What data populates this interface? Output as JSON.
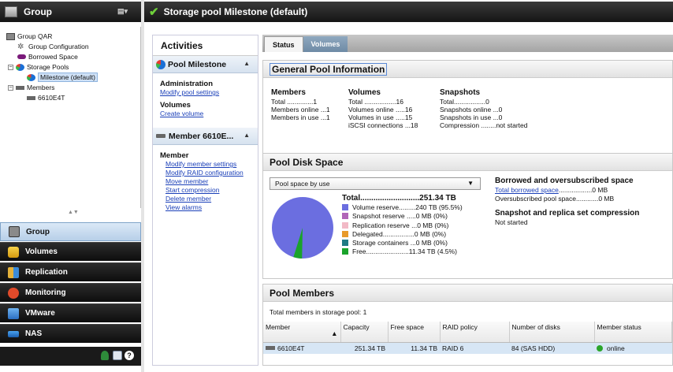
{
  "left": {
    "title": "Group",
    "tree": [
      {
        "label": "Group QAR"
      },
      {
        "label": "Group Configuration"
      },
      {
        "label": "Borrowed Space"
      },
      {
        "label": "Storage Pools"
      },
      {
        "label": "Milestone (default)"
      },
      {
        "label": "Members"
      },
      {
        "label": "6610E4T"
      }
    ],
    "nav": [
      "Group",
      "Volumes",
      "Replication",
      "Monitoring",
      "VMware",
      "NAS"
    ]
  },
  "main": {
    "title": "Storage pool Milestone (default)"
  },
  "activities": {
    "title": "Activities",
    "pool_section": "Pool Milestone",
    "admin_header": "Administration",
    "admin_links": [
      "Modify pool settings"
    ],
    "volumes_header": "Volumes",
    "volumes_links": [
      "Create volume"
    ],
    "member_section": "Member 6610E...",
    "member_header": "Member",
    "member_links": [
      "Modify member settings",
      "Modify RAID configuration",
      "Move member",
      "Start compression",
      "Delete member",
      "View alarms"
    ]
  },
  "tabs": [
    "Status",
    "Volumes"
  ],
  "general": {
    "title": "General Pool Information",
    "members": {
      "header": "Members",
      "rows": [
        "Total ..............1",
        "Members online ...1",
        "Members in use ...1"
      ]
    },
    "volumes": {
      "header": "Volumes",
      "rows": [
        "Total .................16",
        "Volumes online .....16",
        "Volumes in use .....15",
        "iSCSI connections ...18"
      ]
    },
    "snapshots": {
      "header": "Snapshots",
      "rows": [
        "Total.................0",
        "Snapshots online ...0",
        "Snapshots in use ...0",
        "Compression ........not started"
      ]
    }
  },
  "disk": {
    "title": "Pool Disk Space",
    "dropdown": "Pool space by use",
    "total_label": "Total...........................251.34 TB",
    "legend": [
      {
        "label": "Volume reserve.........240 TB (95.5%)",
        "color": "#6b6ee0"
      },
      {
        "label": "Snapshot reserve .....0 MB (0%)",
        "color": "#b065b8"
      },
      {
        "label": "Replication reserve ...0 MB (0%)",
        "color": "#f2b9c6"
      },
      {
        "label": "Delegated.................0 MB (0%)",
        "color": "#e89a2a"
      },
      {
        "label": "Storage containers ...0 MB (0%)",
        "color": "#1f7a83"
      },
      {
        "label": "Free.......................11.34 TB (4.5%)",
        "color": "#1aa32b"
      }
    ],
    "borrowed_header": "Borrowed and oversubscribed space",
    "borrowed_link": "Total borrowed space",
    "borrowed_value": "..................0 MB",
    "oversub": "Oversubscribed pool space............0 MB",
    "snap_header": "Snapshot and replica set compression",
    "snap_status": "Not started"
  },
  "pool_members": {
    "title": "Pool Members",
    "count_text": "Total members in storage pool: 1",
    "columns": [
      "Member",
      "Capacity",
      "Free space",
      "RAID policy",
      "Number of disks",
      "Member status"
    ],
    "rows": [
      {
        "member": "6610E4T",
        "capacity": "251.34 TB",
        "free": "11.34 TB",
        "raid": "RAID 6",
        "disks": "84 (SAS HDD)",
        "status": "online"
      }
    ]
  }
}
